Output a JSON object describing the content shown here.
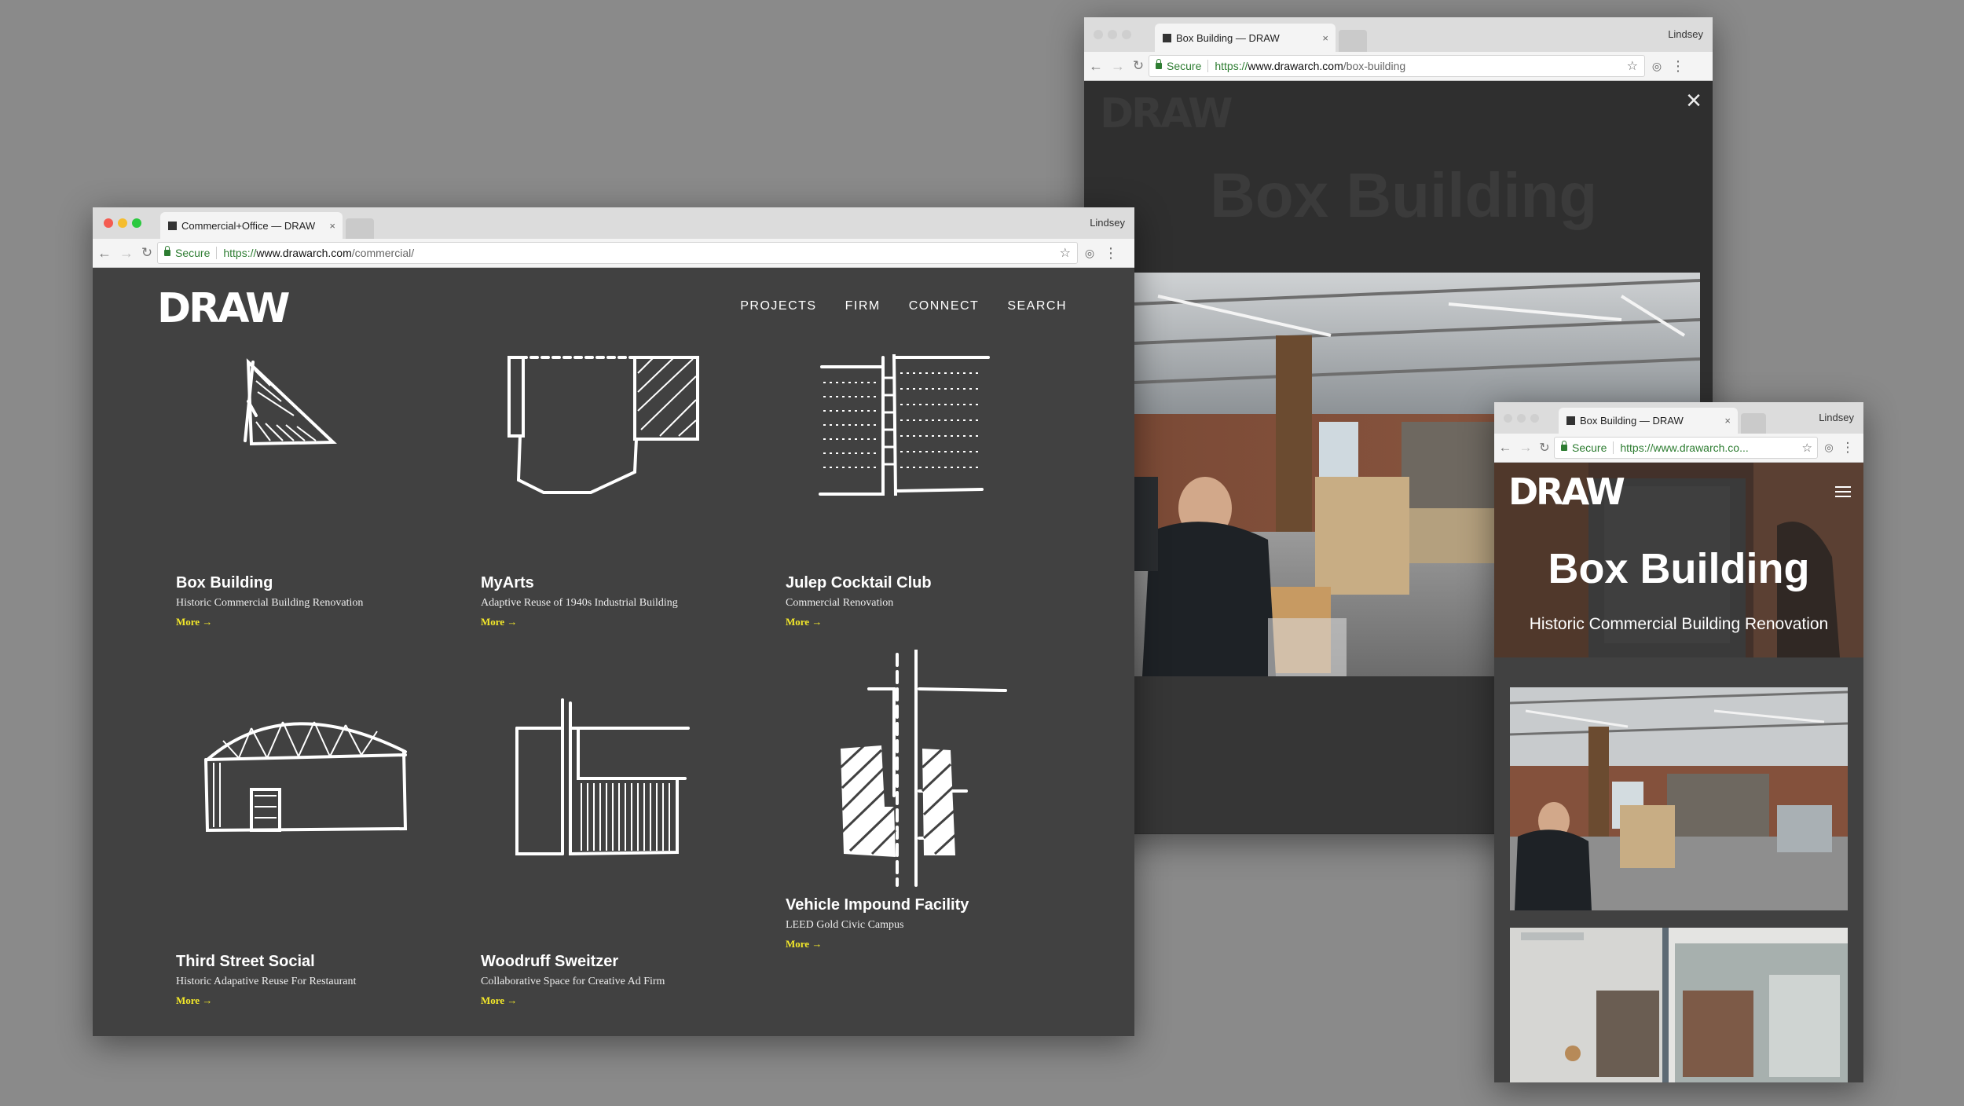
{
  "main_window": {
    "tab_title": "Commercial+Office — DRAW",
    "user": "Lindsey",
    "secure_label": "Secure",
    "url_protocol": "https://",
    "url_host": "www.drawarch.com",
    "url_path": "/commercial/",
    "site": {
      "logo": "DRAW",
      "nav": [
        "PROJECTS",
        "FIRM",
        "CONNECT",
        "SEARCH"
      ],
      "more_label": "More →",
      "projects": [
        {
          "title": "Box Building",
          "subtitle": "Historic Commercial Building Renovation"
        },
        {
          "title": "MyArts",
          "subtitle": "Adaptive Reuse of 1940s Industrial Building"
        },
        {
          "title": "Julep Cocktail Club",
          "subtitle": "Commercial Renovation"
        },
        {
          "title": "Third Street Social",
          "subtitle": "Historic Adapative Reuse For Restaurant"
        },
        {
          "title": "Woodruff Sweitzer",
          "subtitle": "Collaborative Space for Creative Ad Firm"
        },
        {
          "title": "Vehicle Impound Facility",
          "subtitle": "LEED Gold Civic Campus"
        }
      ]
    }
  },
  "overlay_window": {
    "tab_title": "Box Building — DRAW",
    "user": "Lindsey",
    "secure_label": "Secure",
    "url_protocol": "https://",
    "url_host": "www.drawarch.com",
    "url_path": "/box-building",
    "faded_logo": "DRAW",
    "faded_title": "Box Building",
    "close_icon": "×"
  },
  "mobile_window": {
    "tab_title": "Box Building — DRAW",
    "user": "Lindsey",
    "secure_label": "Secure",
    "url_display": "https://www.drawarch.co...",
    "logo": "DRAW",
    "hero_title": "Box Building",
    "hero_subtitle": "Historic Commercial Building Renovation"
  },
  "colors": {
    "background": "#8a8a8a",
    "site_bg": "#414141",
    "accent_more": "#f3e82a",
    "secure_green": "#2e7d32"
  },
  "icons": [
    "back-icon",
    "forward-icon",
    "reload-icon",
    "star-icon",
    "extension-icon",
    "menu-dots-icon",
    "hamburger-icon",
    "close-icon"
  ]
}
